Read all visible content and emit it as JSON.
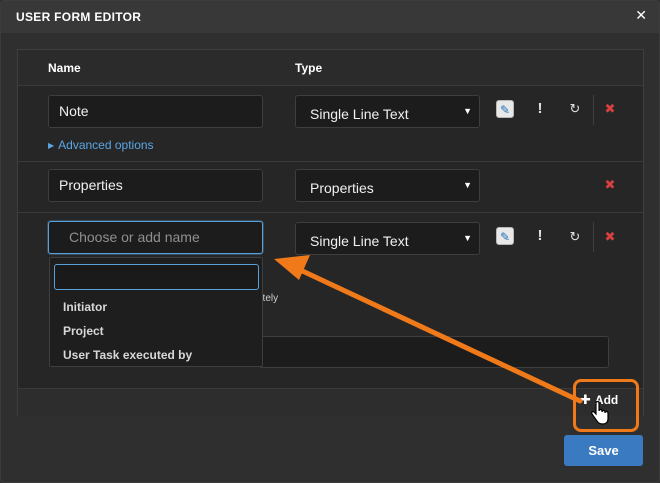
{
  "dialog": {
    "title": "USER FORM EDITOR",
    "close_icon": "close-icon"
  },
  "table": {
    "headers": {
      "name": "Name",
      "type": "Type"
    },
    "rows": [
      {
        "name": "Note",
        "type": "Single Line Text",
        "advanced": "Advanced options"
      },
      {
        "name": "Properties",
        "type": "Properties"
      },
      {
        "name_placeholder": "Choose or add name",
        "type": "Single Line Text"
      }
    ],
    "partially_hidden_text": "ately"
  },
  "dropdown": {
    "search_value": "",
    "options": [
      "Initiator",
      "Project",
      "User Task executed by"
    ]
  },
  "actions": {
    "add_label": "Add",
    "save_label": "Save"
  },
  "colors": {
    "accent": "#3a7ac0",
    "highlight": "#f07a1a",
    "delete": "#d94040",
    "link": "#5aa6e6"
  }
}
